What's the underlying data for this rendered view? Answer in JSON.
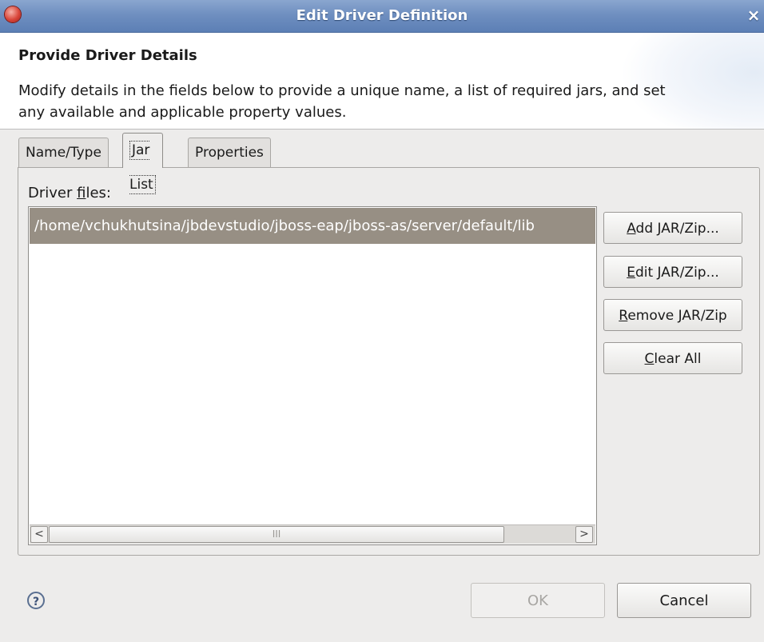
{
  "window": {
    "title": "Edit Driver Definition",
    "close_glyph": "×"
  },
  "header": {
    "title": "Provide Driver Details",
    "description": "Modify details in the fields below to provide a unique name, a list of required jars, and set any available and applicable property values."
  },
  "tabs": [
    {
      "label": "Name/Type",
      "active": false
    },
    {
      "label": "Jar List",
      "active": true
    },
    {
      "label": "Properties",
      "active": false
    }
  ],
  "jar_list": {
    "label_prefix": "Driver ",
    "label_mnemonic": "f",
    "label_suffix": "iles:",
    "files": [
      "/home/vchukhutsina/jbdevstudio/jboss-eap/jboss-as/server/default/lib"
    ],
    "selected_index": 0,
    "scroll_left_glyph": "<",
    "scroll_right_glyph": ">",
    "scroll_grip": "III"
  },
  "side_buttons": {
    "add": {
      "mnemonic": "A",
      "rest": "dd JAR/Zip..."
    },
    "edit": {
      "mnemonic": "E",
      "rest": "dit JAR/Zip..."
    },
    "remove": {
      "mnemonic": "R",
      "rest": "emove JAR/Zip"
    },
    "clear": {
      "mnemonic": "C",
      "rest": "lear All"
    }
  },
  "footer": {
    "help_glyph": "?",
    "ok_label": "OK",
    "ok_enabled": false,
    "cancel_label": "Cancel"
  },
  "icons": {
    "app": "eclipse-app-icon",
    "close": "close-icon",
    "help": "help-icon"
  },
  "colors": {
    "titlebar": "#6f8fc0",
    "selection": "#978f84",
    "background": "#edeceb"
  }
}
